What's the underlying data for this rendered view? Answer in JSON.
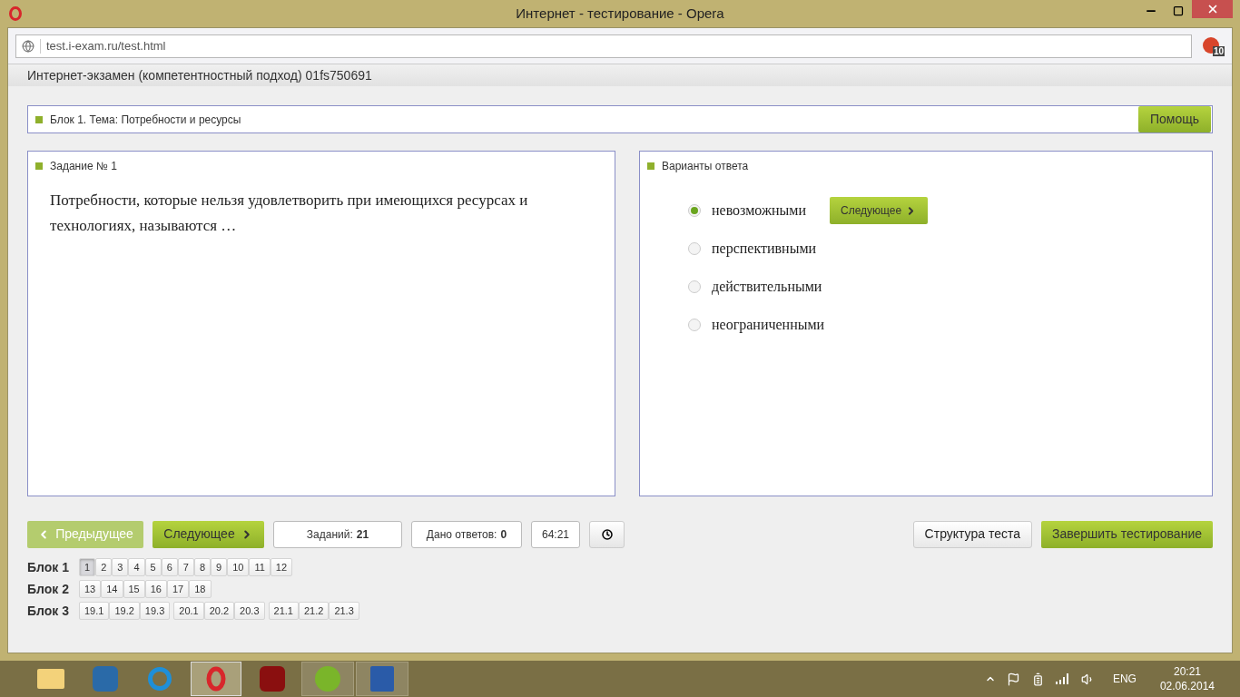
{
  "window": {
    "title": "Интернет - тестирование - Opera"
  },
  "browser": {
    "url": "test.i-exam.ru/test.html",
    "adblock_count": "10"
  },
  "page": {
    "header": "Интернет-экзамен (компетентностный подход) 01fs750691"
  },
  "block_bar": {
    "label": "Блок 1. Тема: Потребности и ресурсы",
    "help": "Помощь"
  },
  "task": {
    "title": "Задание № 1",
    "question": "Потребности, которые нельзя удовлетворить при имеющихся ресурсах и технологиях, называются …"
  },
  "answers": {
    "title": "Варианты ответа",
    "next": "Следующее",
    "options": [
      {
        "label": "невозможными",
        "selected": true
      },
      {
        "label": "перспективными",
        "selected": false
      },
      {
        "label": "действительными",
        "selected": false
      },
      {
        "label": "неограниченными",
        "selected": false
      }
    ]
  },
  "controls": {
    "prev": {
      "label": "Предыдущее",
      "disabled": true
    },
    "next": {
      "label": "Следующее",
      "disabled": false
    },
    "tasks_label": "Заданий:",
    "tasks_value": "21",
    "answered_label": "Дано ответов:",
    "answered_value": "0",
    "timer": "64:21",
    "structure": "Структура теста",
    "finish": "Завершить тестирование"
  },
  "navigation": [
    {
      "label": "Блок 1",
      "groups": [
        [
          {
            "label": "1",
            "selected": true
          },
          {
            "label": "2",
            "selected": false
          },
          {
            "label": "3",
            "selected": false
          },
          {
            "label": "4",
            "selected": false
          },
          {
            "label": "5",
            "selected": false
          },
          {
            "label": "6",
            "selected": false
          },
          {
            "label": "7",
            "selected": false
          },
          {
            "label": "8",
            "selected": false
          },
          {
            "label": "9",
            "selected": false
          },
          {
            "label": "10",
            "selected": false
          },
          {
            "label": "11",
            "selected": false
          },
          {
            "label": "12",
            "selected": false
          }
        ]
      ]
    },
    {
      "label": "Блок 2",
      "groups": [
        [
          {
            "label": "13",
            "selected": false
          },
          {
            "label": "14",
            "selected": false
          },
          {
            "label": "15",
            "selected": false
          },
          {
            "label": "16",
            "selected": false
          },
          {
            "label": "17",
            "selected": false
          },
          {
            "label": "18",
            "selected": false
          }
        ]
      ]
    },
    {
      "label": "Блок 3",
      "groups": [
        [
          {
            "label": "19.1",
            "selected": false
          },
          {
            "label": "19.2",
            "selected": false
          },
          {
            "label": "19.3",
            "selected": false
          }
        ],
        [
          {
            "label": "20.1",
            "selected": false
          },
          {
            "label": "20.2",
            "selected": false
          },
          {
            "label": "20.3",
            "selected": false
          }
        ],
        [
          {
            "label": "21.1",
            "selected": false
          },
          {
            "label": "21.2",
            "selected": false
          },
          {
            "label": "21.3",
            "selected": false
          }
        ]
      ]
    }
  ],
  "taskbar": {
    "language": "ENG",
    "time": "20:21",
    "date": "02.06.2014"
  }
}
